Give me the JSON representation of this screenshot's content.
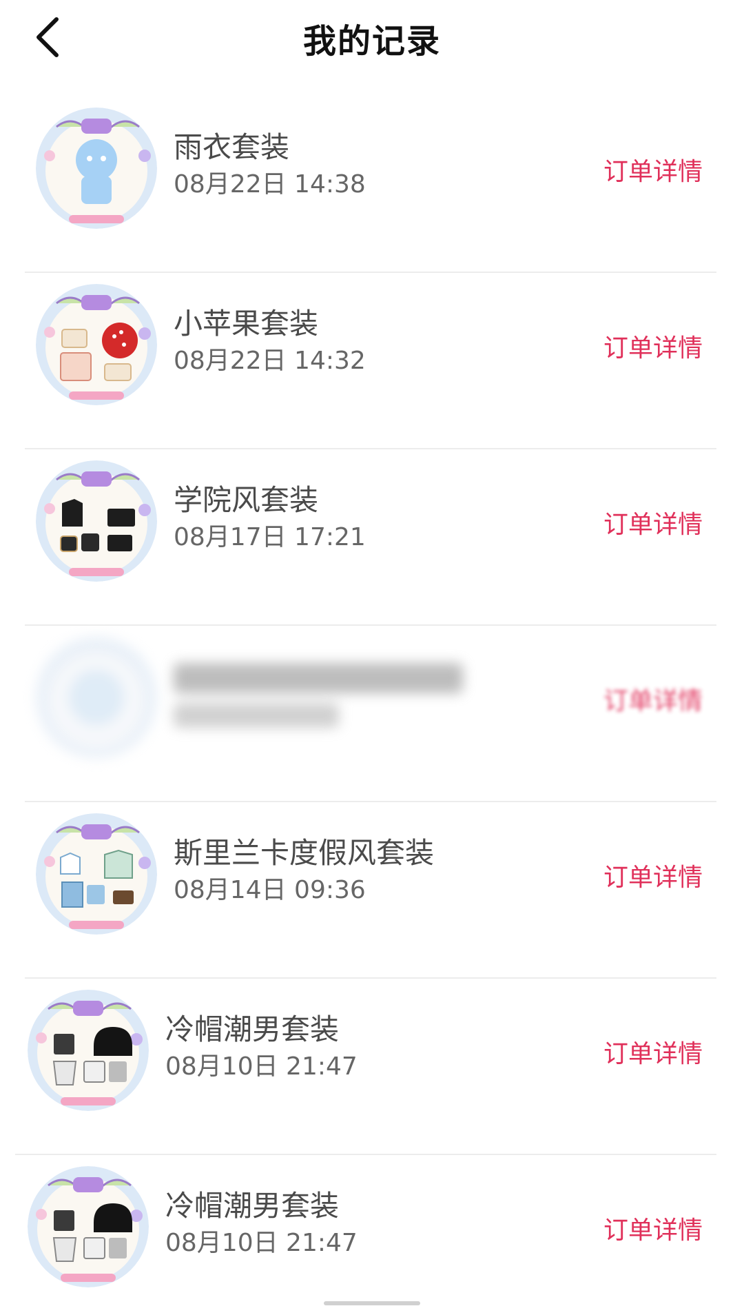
{
  "header": {
    "title": "我的记录",
    "back_icon": "chevron-left-icon"
  },
  "colors": {
    "accent": "#e0305a",
    "title": "#111111",
    "name": "#4a4a4a",
    "time": "#666666",
    "divider": "#ececec"
  },
  "records": [
    {
      "name": "雨衣套装",
      "time": "08月22日 14:38",
      "action": "订单详情",
      "thumb": "raincoat-set-thumbnail",
      "blurred": false
    },
    {
      "name": "小苹果套装",
      "time": "08月22日 14:32",
      "action": "订单详情",
      "thumb": "apple-set-thumbnail",
      "blurred": false
    },
    {
      "name": "学院风套装",
      "time": "08月17日 17:21",
      "action": "订单详情",
      "thumb": "college-set-thumbnail",
      "blurred": false
    },
    {
      "name": "",
      "time": "",
      "action": "订单详情",
      "thumb": "blurred-thumbnail",
      "blurred": true
    },
    {
      "name": "斯里兰卡度假风套装",
      "time": "08月14日 09:36",
      "action": "订单详情",
      "thumb": "srilanka-set-thumbnail",
      "blurred": false
    },
    {
      "name": "冷帽潮男套装",
      "time": "08月10日 21:47",
      "action": "订单详情",
      "thumb": "beanie-set-thumbnail",
      "blurred": false
    },
    {
      "name": "冷帽潮男套装",
      "time": "08月10日 21:47",
      "action": "订单详情",
      "thumb": "beanie-set-thumbnail",
      "blurred": false
    }
  ]
}
